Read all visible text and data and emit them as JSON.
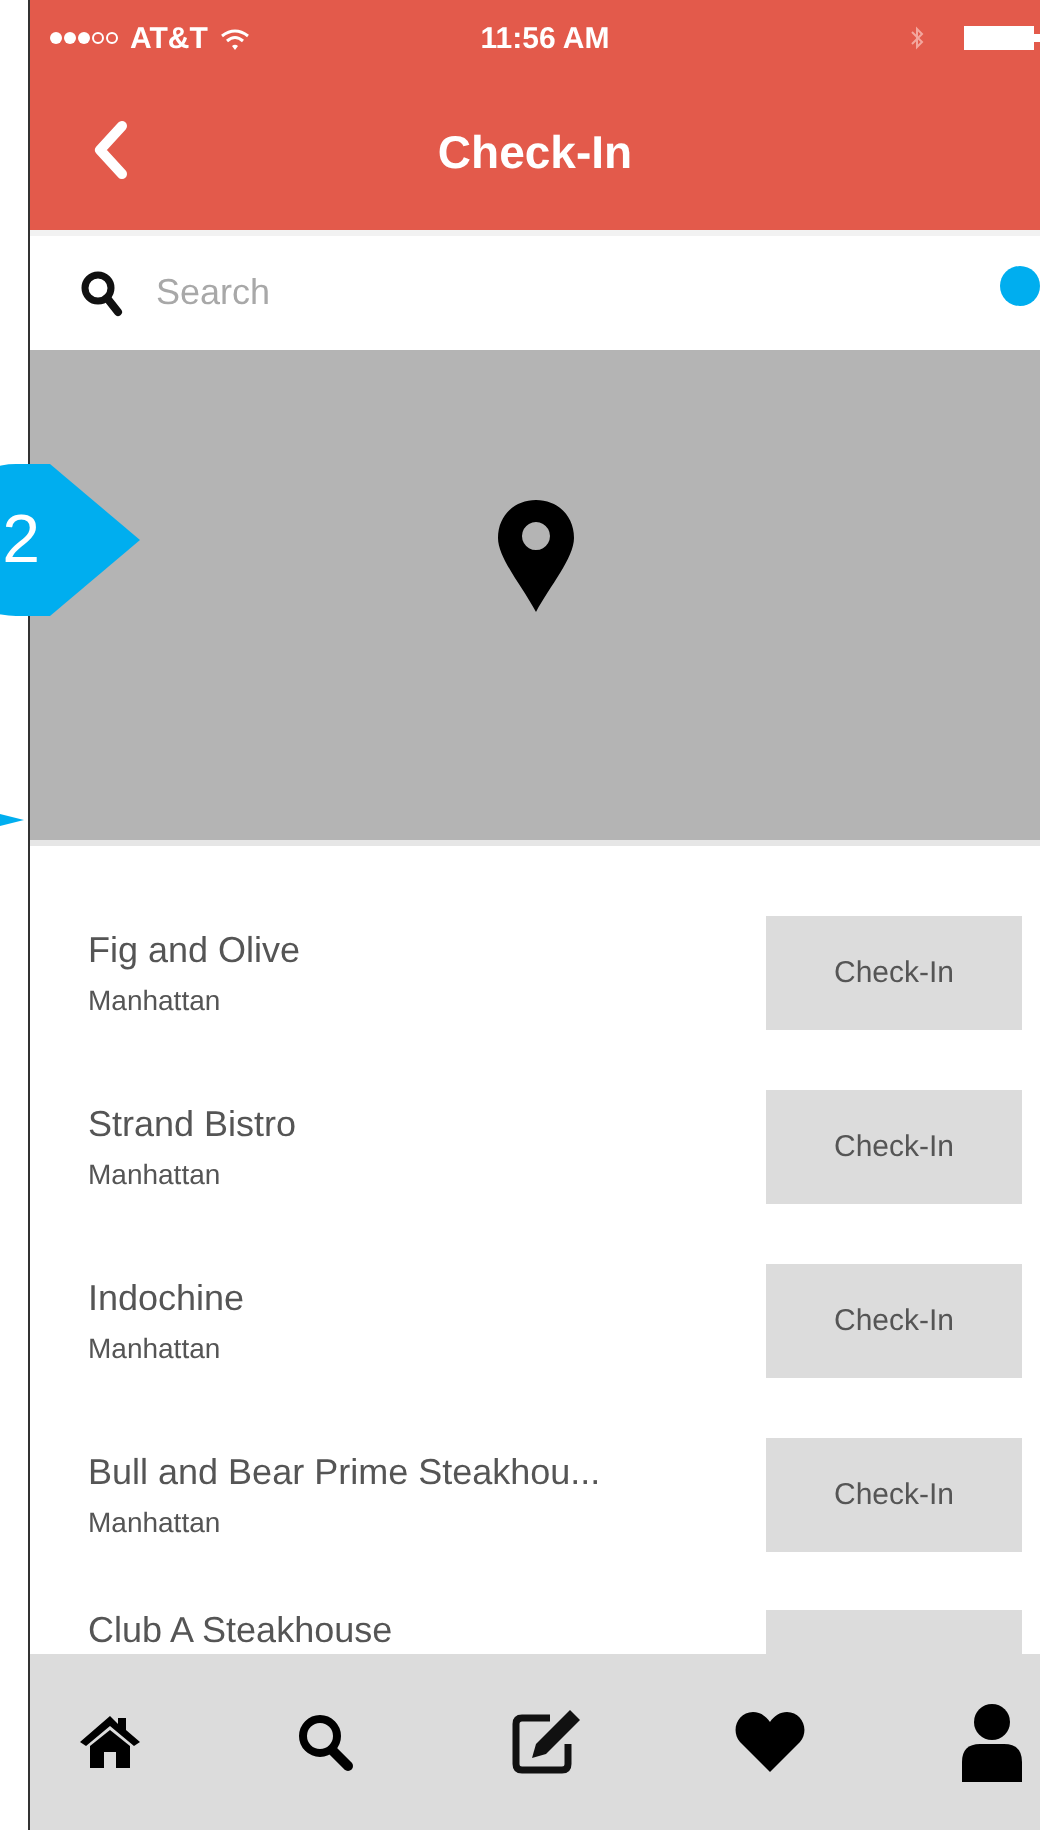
{
  "status_bar": {
    "carrier": "AT&T",
    "time": "11:56 AM"
  },
  "nav_bar": {
    "title": "Check-In"
  },
  "search": {
    "placeholder": "Search"
  },
  "annotation": {
    "number": "2"
  },
  "places": [
    {
      "name": "Fig and Olive",
      "area": "Manhattan",
      "button": "Check-In"
    },
    {
      "name": "Strand Bistro",
      "area": "Manhattan",
      "button": "Check-In"
    },
    {
      "name": "Indochine",
      "area": "Manhattan",
      "button": "Check-In"
    },
    {
      "name": "Bull and Bear Prime Steakhou...",
      "area": "Manhattan",
      "button": "Check-In"
    },
    {
      "name": "Club A Steakhouse"
    }
  ],
  "tab_bar": [
    {
      "kind": "home"
    },
    {
      "kind": "search"
    },
    {
      "kind": "compose"
    },
    {
      "kind": "heart"
    },
    {
      "kind": "person"
    }
  ]
}
